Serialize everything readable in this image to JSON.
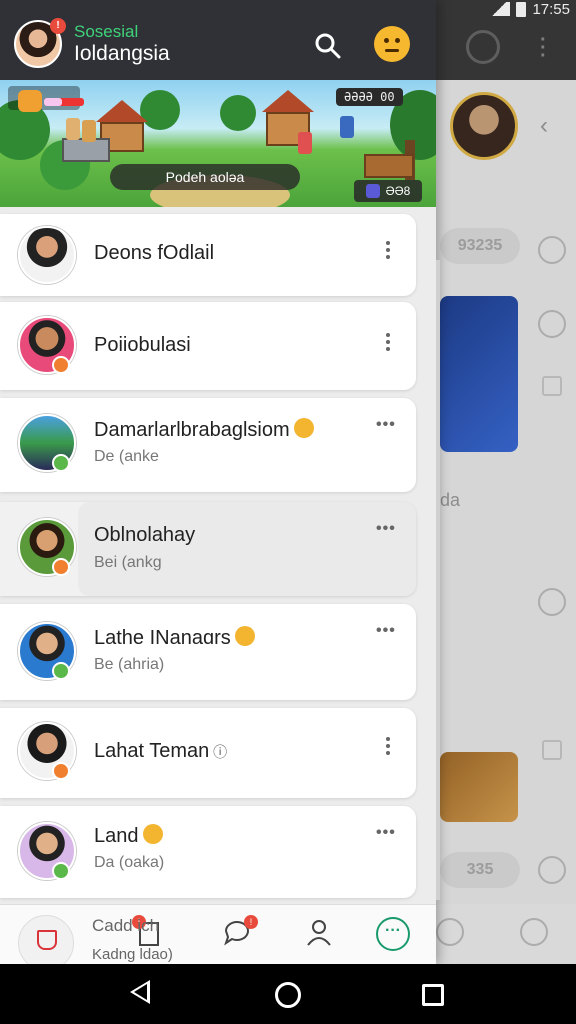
{
  "status_bar": {
    "time": "17:55"
  },
  "header": {
    "app_name": "Sosesial",
    "user_name": "Ioldangsia",
    "header_badge": "!"
  },
  "banner": {
    "score": "ƏƏƏƏ 00",
    "button_label": "Podeh aoləa",
    "coins": "ƏƏ8"
  },
  "contacts": [
    {
      "name": "Deons fOdlail",
      "status": ""
    },
    {
      "name": "Poiiobulasi",
      "status": ""
    },
    {
      "name": "Damarlarlbrabaglsiom",
      "status": "De (anke"
    },
    {
      "name": "Oblnolahay",
      "status": "Bei (ankɡ"
    },
    {
      "name": "Lathe INanaɑrs",
      "status": "Be (ahria)"
    },
    {
      "name": "Lahat Teman",
      "status": ""
    },
    {
      "name": "Land",
      "status": "Da (oaka)"
    }
  ],
  "bottom_nav": {
    "label_line1": "Cadd   ich",
    "label_line2": "Kadng ldao)",
    "badge_1": "!",
    "badge_2": "!"
  },
  "background_panel": {
    "pill_1": "93235",
    "pill_2": "335",
    "text_1": "da"
  },
  "colors": {
    "header_bg": "#2f3136",
    "accent_green": "#3fd27a",
    "more_button": "#1a9a6c",
    "badge_red": "#e84b3c"
  }
}
